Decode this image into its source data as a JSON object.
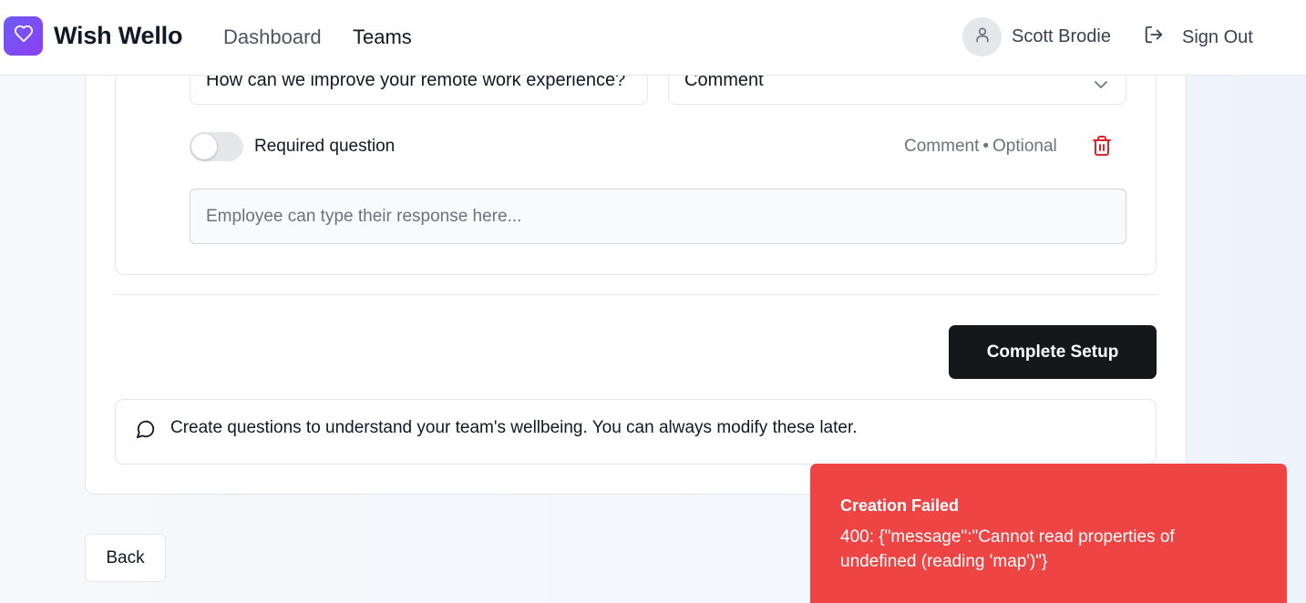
{
  "header": {
    "app_name": "Wish Wello",
    "nav": {
      "dashboard": "Dashboard",
      "teams": "Teams"
    },
    "user_name": "Scott Brodie",
    "sign_out": "Sign Out",
    "brand_gradient": [
      "#6d5cf6",
      "#8b3ff0"
    ]
  },
  "question": {
    "text": "How can we improve your remote work experience?",
    "type": "Comment",
    "required_label": "Required question",
    "required_on": false,
    "meta_type": "Comment",
    "meta_separator": "•",
    "meta_status": "Optional",
    "response_placeholder": "Employee can type their response here..."
  },
  "actions": {
    "complete_label": "Complete Setup",
    "back_label": "Back"
  },
  "info": {
    "text": "Create questions to understand your team's wellbeing. You can always modify these later."
  },
  "toast": {
    "title": "Creation Failed",
    "message": "400: {\"message\":\"Cannot read properties of undefined (reading 'map')\"}",
    "color": "#ef4444"
  },
  "icons": {
    "logo": "heart-icon",
    "avatar": "user-icon",
    "signout": "log-out-icon",
    "select": "chevron-down-icon",
    "delete": "trash-icon",
    "info": "message-circle-icon"
  }
}
